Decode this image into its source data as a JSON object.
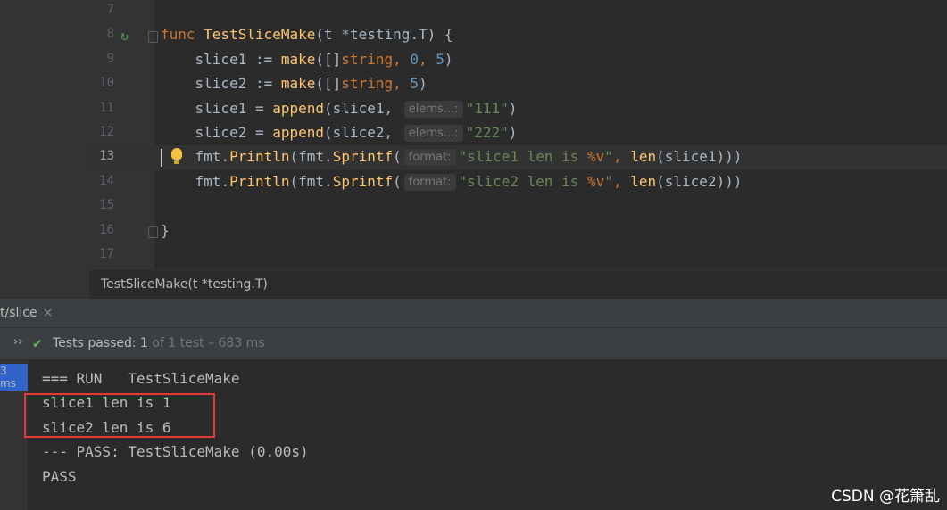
{
  "editor": {
    "line_numbers": [
      "7",
      "8",
      "9",
      "10",
      "11",
      "12",
      "13",
      "14",
      "15",
      "16",
      "17"
    ],
    "current_line": "13",
    "lines": [
      {
        "tokens": []
      },
      {
        "tokens": [
          {
            "t": "func ",
            "c": "kw"
          },
          {
            "t": "TestSliceMake",
            "c": "fn"
          },
          {
            "t": "(t *testing.T) {",
            "c": "plain"
          }
        ]
      },
      {
        "tokens": [
          {
            "t": "    slice1 := ",
            "c": "plain"
          },
          {
            "t": "make",
            "c": "fn"
          },
          {
            "t": "([]",
            "c": "plain"
          },
          {
            "t": "string",
            "c": "kw"
          },
          {
            "t": ", ",
            "c": "kw"
          },
          {
            "t": "0",
            "c": "num"
          },
          {
            "t": ", ",
            "c": "kw"
          },
          {
            "t": "5",
            "c": "num"
          },
          {
            "t": ")",
            "c": "plain"
          }
        ]
      },
      {
        "tokens": [
          {
            "t": "    slice2 := ",
            "c": "plain"
          },
          {
            "t": "make",
            "c": "fn"
          },
          {
            "t": "([]",
            "c": "plain"
          },
          {
            "t": "string",
            "c": "kw"
          },
          {
            "t": ", ",
            "c": "kw"
          },
          {
            "t": "5",
            "c": "num"
          },
          {
            "t": ")",
            "c": "plain"
          }
        ]
      },
      {
        "tokens": [
          {
            "t": "    slice1 = ",
            "c": "plain"
          },
          {
            "t": "append",
            "c": "fn"
          },
          {
            "t": "(slice1, ",
            "c": "plain"
          },
          {
            "t": "elems...:",
            "c": "hint"
          },
          {
            "t": "\"111\"",
            "c": "str"
          },
          {
            "t": ")",
            "c": "plain"
          }
        ]
      },
      {
        "tokens": [
          {
            "t": "    slice2 = ",
            "c": "plain"
          },
          {
            "t": "append",
            "c": "fn"
          },
          {
            "t": "(slice2, ",
            "c": "plain"
          },
          {
            "t": "elems...:",
            "c": "hint"
          },
          {
            "t": "\"222\"",
            "c": "str"
          },
          {
            "t": ")",
            "c": "plain"
          }
        ]
      },
      {
        "tokens": [
          {
            "t": "    ",
            "c": "plain"
          },
          {
            "t": "fmt",
            "c": "plain"
          },
          {
            "t": ".",
            "c": "plain"
          },
          {
            "t": "Println",
            "c": "fn"
          },
          {
            "t": "(fmt.",
            "c": "plain"
          },
          {
            "t": "Sprintf",
            "c": "fn"
          },
          {
            "t": "(",
            "c": "plain"
          },
          {
            "t": "format:",
            "c": "hint"
          },
          {
            "t": "\"slice1 len is ",
            "c": "str"
          },
          {
            "t": "%v",
            "c": "fmt"
          },
          {
            "t": "\"",
            "c": "str"
          },
          {
            "t": ", ",
            "c": "kw"
          },
          {
            "t": "len",
            "c": "fn"
          },
          {
            "t": "(slice1)))",
            "c": "plain"
          }
        ]
      },
      {
        "tokens": [
          {
            "t": "    ",
            "c": "plain"
          },
          {
            "t": "fmt",
            "c": "plain"
          },
          {
            "t": ".",
            "c": "plain"
          },
          {
            "t": "Println",
            "c": "fn"
          },
          {
            "t": "(fmt.",
            "c": "plain"
          },
          {
            "t": "Sprintf",
            "c": "fn"
          },
          {
            "t": "(",
            "c": "plain"
          },
          {
            "t": "format:",
            "c": "hint"
          },
          {
            "t": "\"slice2 len is ",
            "c": "str"
          },
          {
            "t": "%v",
            "c": "fmt"
          },
          {
            "t": "\"",
            "c": "str"
          },
          {
            "t": ", ",
            "c": "kw"
          },
          {
            "t": "len",
            "c": "fn"
          },
          {
            "t": "(slice2)))",
            "c": "plain"
          }
        ]
      },
      {
        "tokens": []
      },
      {
        "tokens": [
          {
            "t": "}",
            "c": "plain"
          }
        ]
      },
      {
        "tokens": []
      }
    ],
    "breadcrumb": "TestSliceMake(t *testing.T)"
  },
  "run_panel": {
    "tab_label": "t/slice",
    "tab_close": "×",
    "expand_glyph": "››",
    "tests_passed_label": "Tests passed: ",
    "tests_passed_count": "1",
    "tests_passed_detail": " of 1 test – 683 ms",
    "tree_item": "3 ms",
    "console_lines": [
      "=== RUN   TestSliceMake",
      "slice1 len is 1",
      "slice2 len is 6",
      "--- PASS: TestSliceMake (0.00s)",
      "PASS"
    ]
  },
  "watermark": "CSDN @花箫乱",
  "colors": {
    "keyword": "#cc7832",
    "function": "#ffc66d",
    "number": "#6897bb",
    "string": "#6a8759",
    "pass_green": "#5fb05f",
    "highlight_box": "#e53935"
  },
  "icons": {
    "run_gutter": "run-test-icon",
    "bulb": "lightbulb-icon",
    "check": "check-icon"
  }
}
